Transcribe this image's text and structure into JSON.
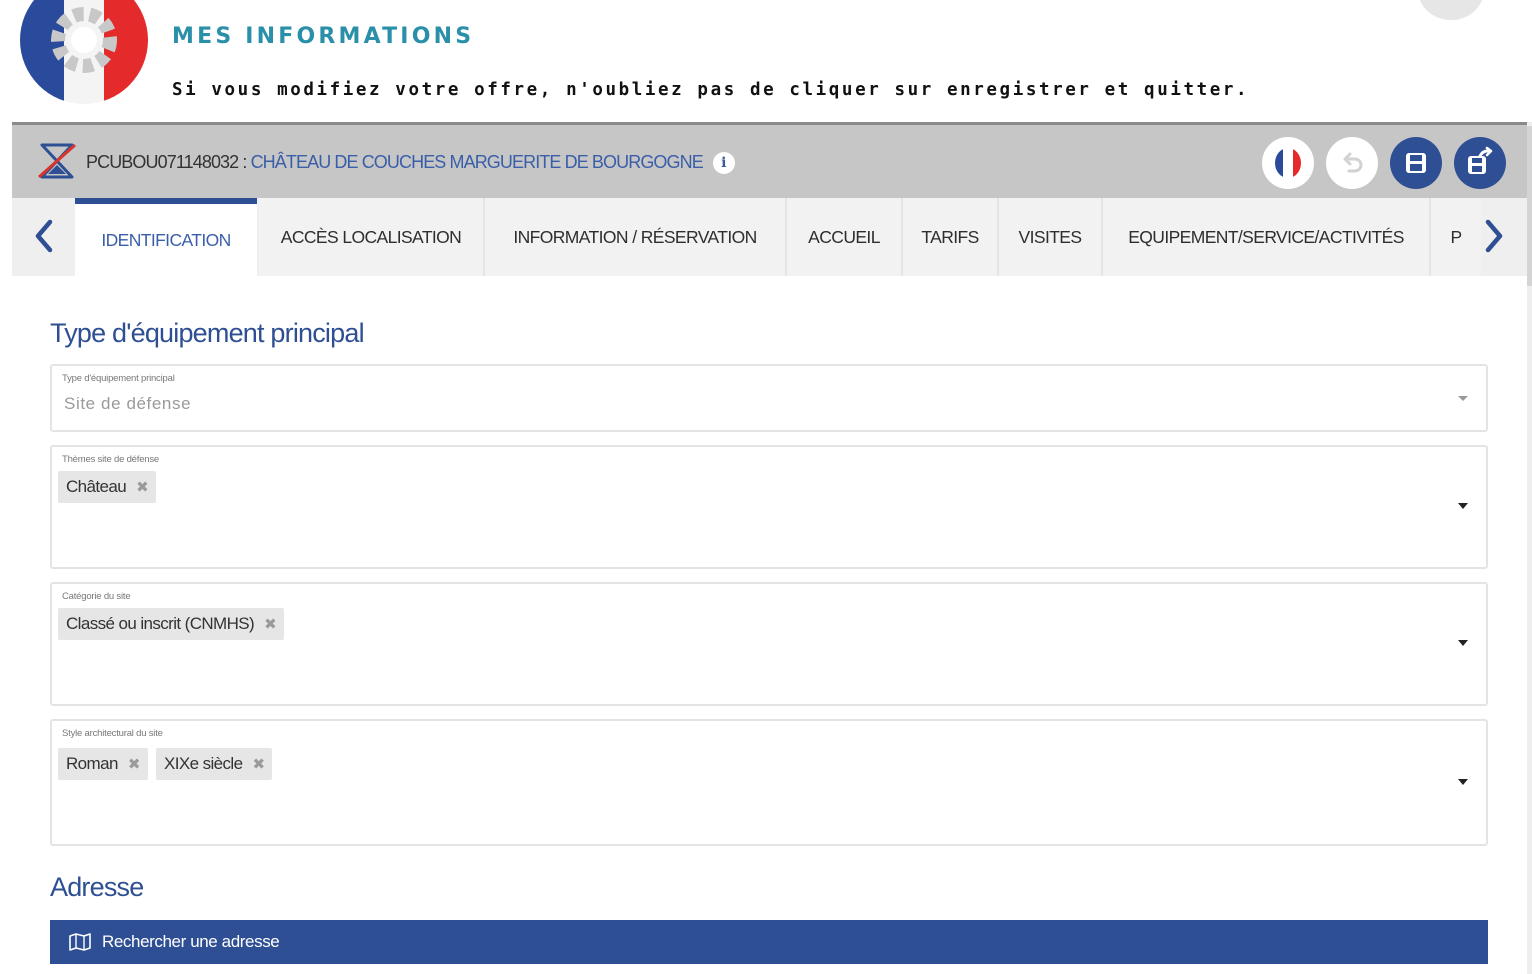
{
  "header": {
    "title": "MES INFORMATIONS",
    "subtitle": "Si vous modifiez votre offre, n'oubliez pas de cliquer sur enregistrer et quitter."
  },
  "record": {
    "code": "PCUBOU071148032 : ",
    "name": "CHÂTEAU DE COUCHES MARGUERITE DE BOURGOGNE",
    "info_icon": "i"
  },
  "toolbar": {
    "icons": [
      "french-flag-icon",
      "undo-icon",
      "save-icon",
      "save-and-quit-icon"
    ]
  },
  "tabs": [
    {
      "label": "IDENTIFICATION",
      "active": true
    },
    {
      "label": "ACCÈS LOCALISATION",
      "active": false
    },
    {
      "label": "INFORMATION / RÉSERVATION",
      "active": false
    },
    {
      "label": "ACCUEIL",
      "active": false
    },
    {
      "label": "TARIFS",
      "active": false
    },
    {
      "label": "VISITES",
      "active": false
    },
    {
      "label": "EQUIPEMENT/SERVICE/ACTIVITÉS",
      "active": false
    },
    {
      "label": "P",
      "active": false
    }
  ],
  "section_main": {
    "title": "Type d'équipement principal",
    "fields": [
      {
        "label": "Type d'équipement principal",
        "value": "Site de défense"
      },
      {
        "label": "Thèmes site de défense",
        "tags": [
          "Château"
        ]
      },
      {
        "label": "Catégorie du site",
        "tags": [
          "Classé ou inscrit (CNMHS)"
        ]
      },
      {
        "label": "Style architectural du site",
        "tags": [
          "Roman",
          "XIXe siècle"
        ]
      }
    ]
  },
  "section_address": {
    "title": "Adresse",
    "search_button": "Rechercher une adresse"
  },
  "colors": {
    "primary": "#2e4f94",
    "title_teal": "#2a8fa8",
    "record_bar": "#c6c6c6"
  }
}
